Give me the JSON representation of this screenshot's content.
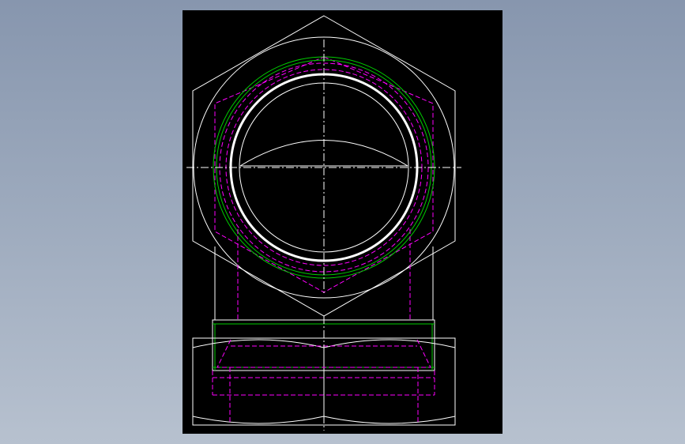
{
  "drawing": {
    "background_color": "#000000",
    "desktop_gradient": [
      "#8796ae",
      "#b7c1cf"
    ],
    "line_colors": {
      "outline": "#ffffff",
      "hidden": "#ff00ff",
      "thread": "#00cc00",
      "centerline": "#ffffff"
    },
    "views": [
      "top-view",
      "front-view"
    ]
  }
}
